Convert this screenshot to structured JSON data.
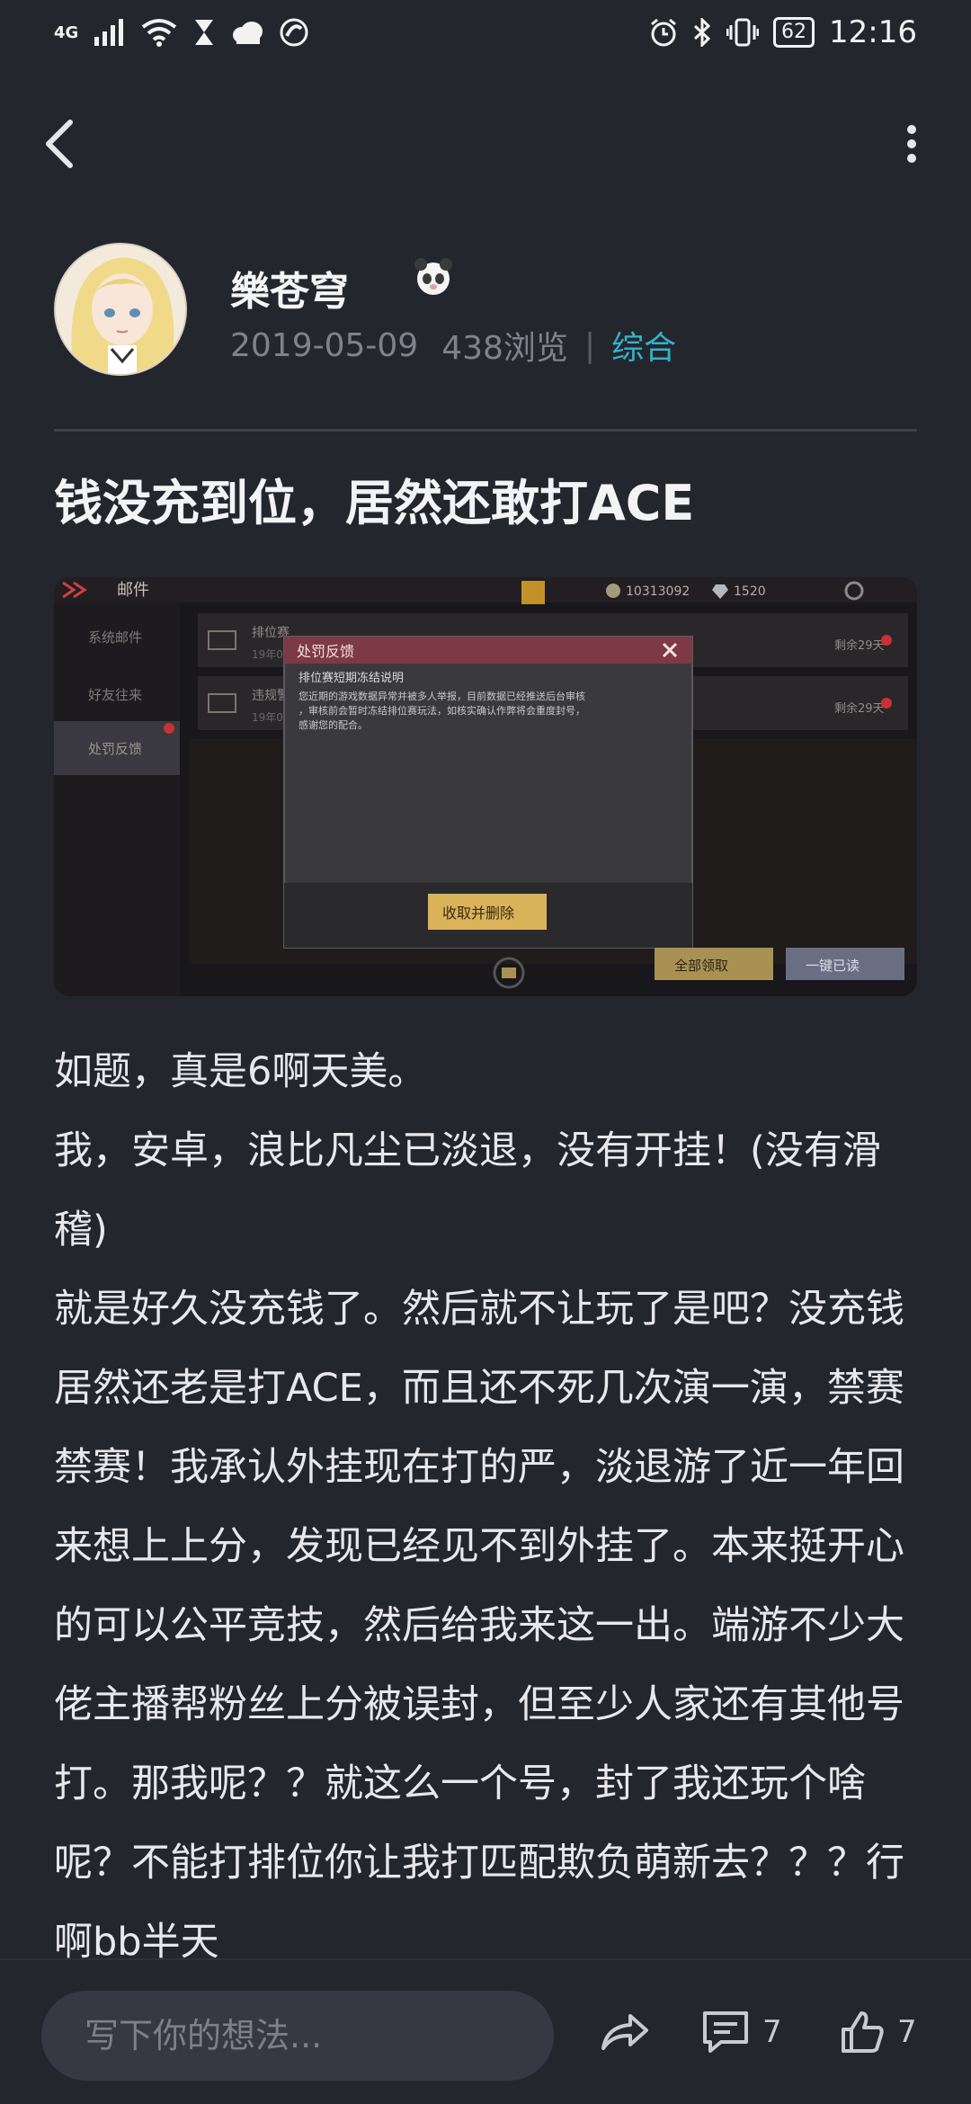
{
  "status_bar": {
    "network": "4G",
    "battery": "62",
    "time": "12:16"
  },
  "author": {
    "name": "樂苍穹",
    "date": "2019-05-09",
    "views": "438浏览",
    "separator": "|",
    "category": "综合"
  },
  "post": {
    "title": "钱没充到位，居然还敢打ACE",
    "paragraphs": [
      "如题，真是6啊天美。",
      "我，安卓，浪比凡尘已淡退，没有开挂！(没有滑稽)",
      "就是好久没充钱了。然后就不让玩了是吧？没充钱居然还老是打ACE，而且还不死几次演一演，禁赛禁赛！我承认外挂现在打的严，淡退游了近一年回来想上上分，发现已经见不到外挂了。本来挺开心的可以公平竞技，然后给我来这一出。端游不少大佬主播帮粉丝上分被误封，但至少人家还有其他号打。那我呢？？就这么一个号，封了我还玩个啥呢？不能打排位你让我打匹配欺负萌新去？？？行啊bb半天"
    ]
  },
  "screenshot": {
    "tab_title": "邮件",
    "coins": "10313092",
    "diamonds": "1520",
    "sidebar": [
      "系统邮件",
      "好友往来",
      "处罚反馈"
    ],
    "mail_items": [
      {
        "title": "排位赛",
        "date": "19年0",
        "remain": "剩余29天"
      },
      {
        "title": "违规警",
        "date": "19年0",
        "remain": "剩余29天"
      }
    ],
    "dialog": {
      "title": "处罚反馈",
      "subject": "排位赛短期冻结说明",
      "lines": [
        "您近期的游戏数据异常并被多人举报，目前数据已经推送后台审核",
        "，审核前会暂时冻结排位赛玩法，如核实确认作弊将会重度封号，",
        "感谢您的配合。"
      ],
      "button": "收取并删除"
    },
    "btn_collect_all": "全部领取",
    "btn_read_all": "一键已读"
  },
  "bottom_bar": {
    "input_placeholder": "写下你的想法...",
    "comments_count": "7",
    "likes_count": "7"
  },
  "colors": {
    "background": "#24262e",
    "accent": "#31b3c9",
    "muted": "#7f828c",
    "input_bg": "#363944"
  },
  "icons": [
    "back-arrow-icon",
    "more-vertical-icon",
    "share-icon",
    "comment-icon",
    "thumbs-up-icon",
    "wifi-icon",
    "bluetooth-icon",
    "alarm-icon",
    "vibrate-icon"
  ]
}
